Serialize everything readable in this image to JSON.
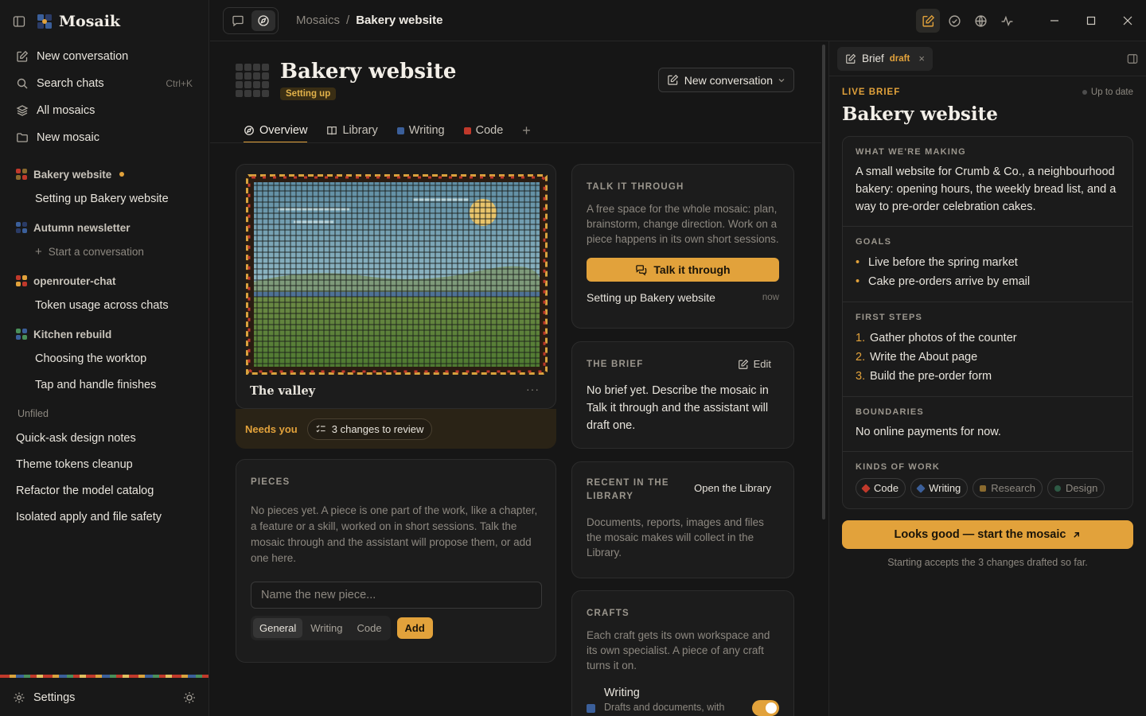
{
  "app": {
    "name": "Mosaik"
  },
  "sidebar": {
    "nav": [
      {
        "label": "New conversation",
        "icon": "edit-icon"
      },
      {
        "label": "Search chats",
        "icon": "search-icon",
        "shortcut": "Ctrl+K"
      },
      {
        "label": "All mosaics",
        "icon": "layers-icon"
      },
      {
        "label": "New mosaic",
        "icon": "folder-icon"
      }
    ],
    "groups": [
      {
        "name": "Bakery website",
        "unread": true,
        "items": [
          "Setting up Bakery website"
        ]
      },
      {
        "name": "Autumn newsletter",
        "empty_action": "Start a conversation"
      },
      {
        "name": "openrouter-chat",
        "items": [
          "Token usage across chats"
        ]
      },
      {
        "name": "Kitchen rebuild",
        "items": [
          "Choosing the worktop",
          "Tap and handle finishes"
        ]
      }
    ],
    "unfiled_label": "Unfiled",
    "unfiled": [
      "Quick-ask design notes",
      "Theme tokens cleanup",
      "Refactor the model catalog",
      "Isolated apply and file safety"
    ],
    "settings_label": "Settings"
  },
  "breadcrumb": {
    "root": "Mosaics",
    "sep": "/",
    "current": "Bakery website"
  },
  "page": {
    "title": "Bakery website",
    "status": "Setting up",
    "new_conversation_label": "New conversation",
    "tabs": [
      {
        "label": "Overview",
        "icon": "compass-icon"
      },
      {
        "label": "Library",
        "icon": "book-icon"
      },
      {
        "label": "Writing",
        "color": "#3b5f9a"
      },
      {
        "label": "Code",
        "color": "#c0392b"
      }
    ]
  },
  "cover": {
    "title": "The valley",
    "menu": "···"
  },
  "needs": {
    "label": "Needs you",
    "review_label": "3 changes to review"
  },
  "pieces": {
    "heading": "PIECES",
    "body": "No pieces yet. A piece is one part of the work, like a chapter, a feature or a skill, worked on in short sessions. Talk the mosaic through and the assistant will propose them, or add one here.",
    "placeholder": "Name the new piece...",
    "types": [
      "General",
      "Writing",
      "Code"
    ],
    "add_label": "Add"
  },
  "talk": {
    "heading": "TALK IT THROUGH",
    "body": "A free space for the whole mosaic: plan, brainstorm, change direction. Work on a piece happens in its own short sessions.",
    "button": "Talk it through",
    "recent": "Setting up Bakery website",
    "recent_time": "now"
  },
  "brief_card": {
    "heading": "THE BRIEF",
    "edit_label": "Edit",
    "body": "No brief yet. Describe the mosaic in Talk it through and the assistant will draft one."
  },
  "library_card": {
    "heading": "RECENT IN THE LIBRARY",
    "link": "Open the Library",
    "body": "Documents, reports, images and files the mosaic makes will collect in the Library."
  },
  "crafts": {
    "heading": "CRAFTS",
    "body": "Each craft gets its own workspace and its own specialist. A piece of any craft turns it on.",
    "items": [
      {
        "name": "Writing",
        "desc": "Drafts and documents, with",
        "color": "#3b5f9a",
        "enabled": true
      }
    ]
  },
  "brief_panel": {
    "tab_label": "Brief",
    "tab_status": "draft",
    "live_label": "LIVE BRIEF",
    "sync_status": "Up to date",
    "title": "Bakery website",
    "making_label": "WHAT WE'RE MAKING",
    "making": "A small website for Crumb & Co., a neighbourhood bakery: opening hours, the weekly bread list, and a way to pre-order celebration cakes.",
    "goals_label": "GOALS",
    "goals": [
      "Live before the spring market",
      "Cake pre-orders arrive by email"
    ],
    "steps_label": "FIRST STEPS",
    "steps": [
      "Gather photos of the counter",
      "Write the About page",
      "Build the pre-order form"
    ],
    "boundaries_label": "BOUNDARIES",
    "boundaries": "No online payments for now.",
    "kinds_label": "KINDS OF WORK",
    "kinds": [
      {
        "name": "Code",
        "color": "#c0392b",
        "active": true
      },
      {
        "name": "Writing",
        "color": "#3b5f9a",
        "active": true
      },
      {
        "name": "Research",
        "color": "#8a6a2e",
        "active": false
      },
      {
        "name": "Design",
        "color": "#2e5a45",
        "active": false
      }
    ],
    "start_label": "Looks good — start the mosaic",
    "start_note": "Starting accepts the 3 changes drafted so far."
  },
  "colors": {
    "accent": "#e2a23b",
    "background": "#161616",
    "card": "#1c1c1c"
  }
}
